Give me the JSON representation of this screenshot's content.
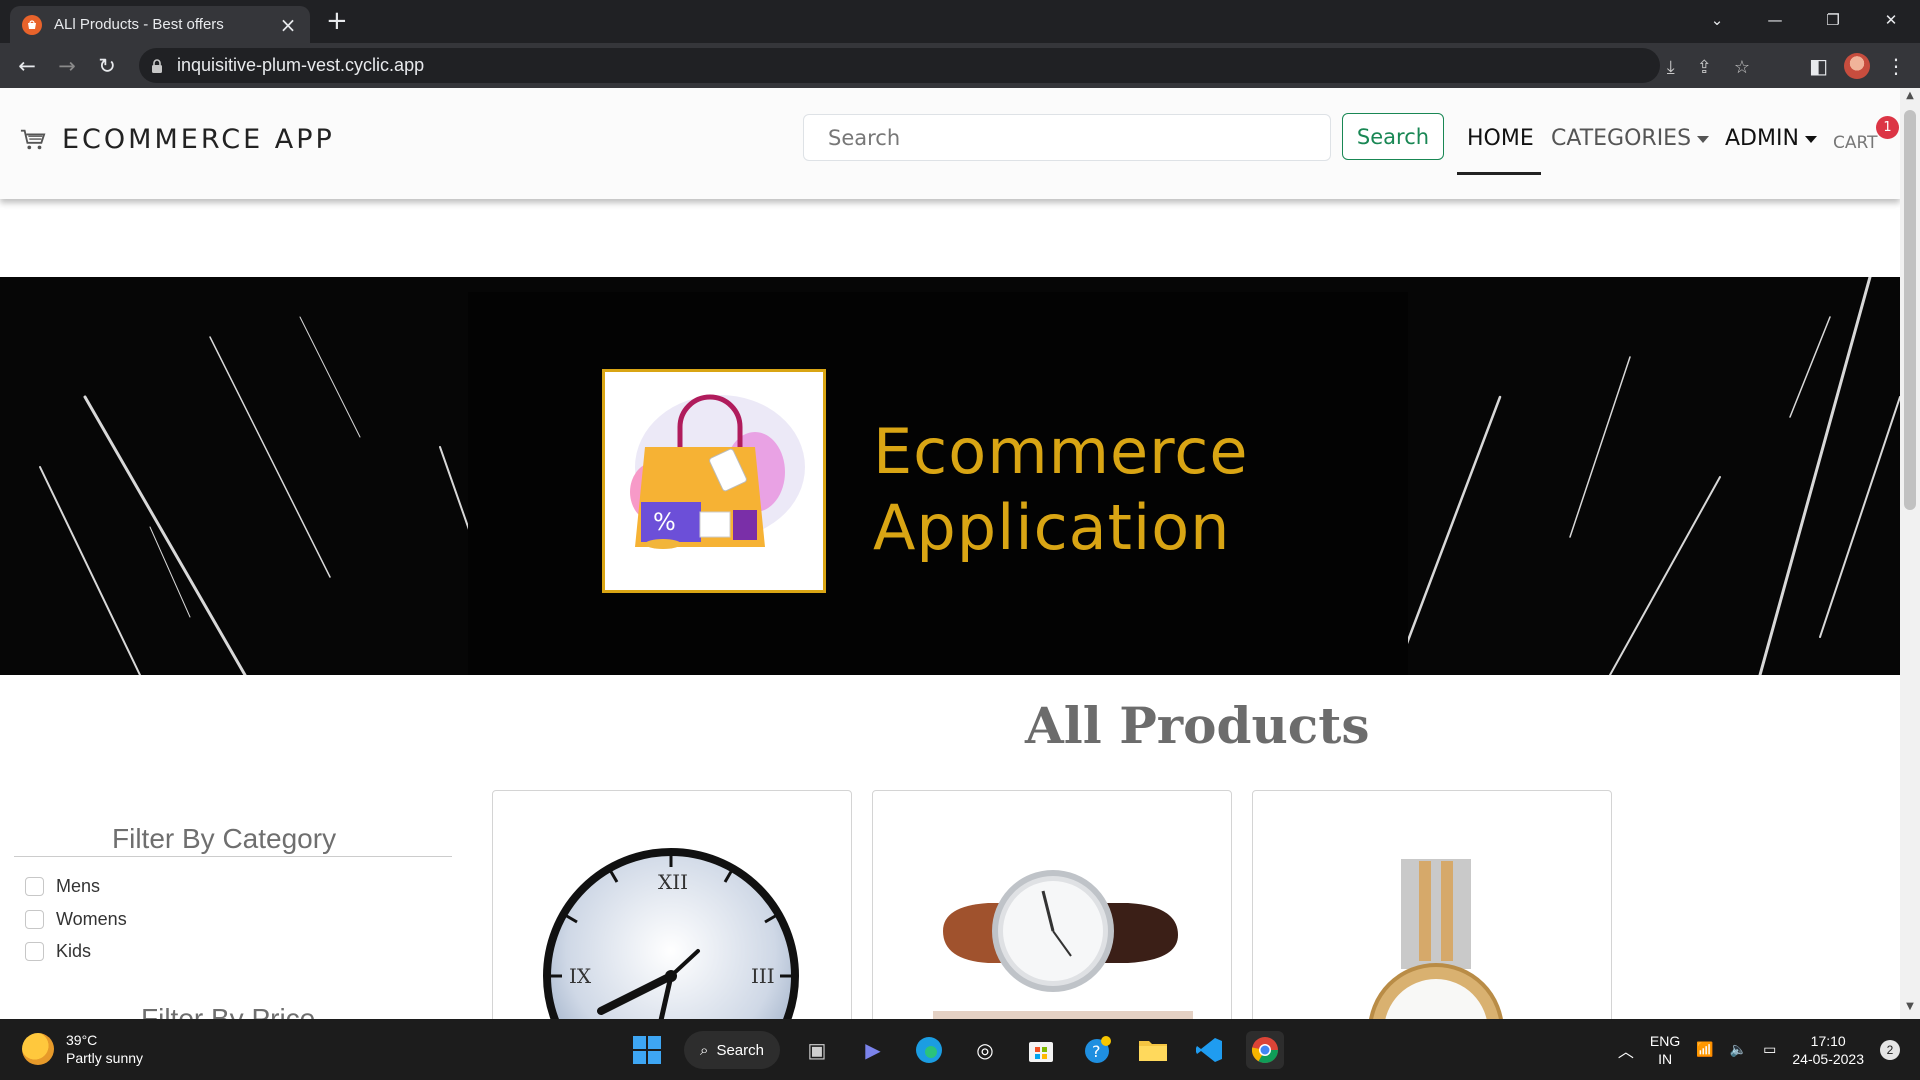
{
  "browser": {
    "tab_title": "ALl Products - Best offers",
    "url": "inquisitive-plum-vest.cyclic.app"
  },
  "site_nav": {
    "brand": "ECOMMERCE APP",
    "search_placeholder": "Search",
    "search_button": "Search",
    "links": {
      "home": "HOME",
      "categories": "CATEGORIES",
      "admin": "ADMIN",
      "cart": "CART"
    },
    "cart_count": "1"
  },
  "hero": {
    "line1": "Ecommerce",
    "line2": "Application"
  },
  "main": {
    "title": "All Products",
    "filter_category_title": "Filter By Category",
    "categories": [
      "Mens",
      "Womens",
      "Kids"
    ],
    "filter_price_title": "Filter By Price"
  },
  "taskbar": {
    "temperature": "39°C",
    "weather": "Partly sunny",
    "search_label": "Search",
    "lang_top": "ENG",
    "lang_bottom": "IN",
    "time": "17:10",
    "date": "24-05-2023",
    "notifications": "2"
  },
  "colors": {
    "accent_green": "#198754",
    "badge_red": "#dc3545",
    "hero_gold": "#d9a514"
  }
}
